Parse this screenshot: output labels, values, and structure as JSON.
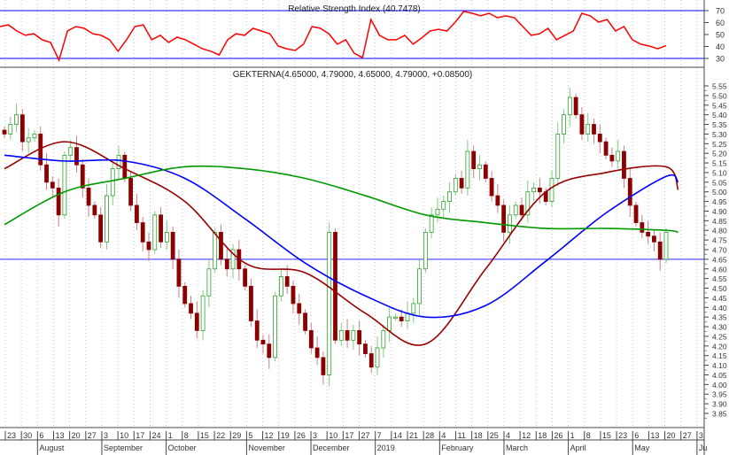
{
  "chart_data": {
    "type": "candlestick",
    "symbol_title": "GEKTERNA(4.65000, 4.79000, 4.65000, 4.79000, +0.08500)",
    "rsi_title": "Relative Strength Index (40.7478)",
    "price_ylim": [
      3.85,
      5.55
    ],
    "price_ticks": [
      "5.55",
      "5.50",
      "5.45",
      "5.40",
      "5.35",
      "5.30",
      "5.25",
      "5.20",
      "5.15",
      "5.10",
      "5.05",
      "5.00",
      "4.95",
      "4.90",
      "4.85",
      "4.80",
      "4.75",
      "4.70",
      "4.65",
      "4.60",
      "4.55",
      "4.50",
      "4.45",
      "4.40",
      "4.35",
      "4.30",
      "4.25",
      "4.20",
      "4.15",
      "4.10",
      "4.05",
      "4.00",
      "3.95",
      "3.90",
      "3.85"
    ],
    "rsi_ylim": [
      30,
      70
    ],
    "rsi_ticks": [
      "70",
      "60",
      "50",
      "40",
      "30"
    ],
    "rsi_levels": [
      70,
      30
    ],
    "support_level": 4.65,
    "week_labels": [
      "23",
      "30",
      "6",
      "13",
      "20",
      "27",
      "3",
      "10",
      "17",
      "24",
      "1",
      "8",
      "15",
      "22",
      "29",
      "5",
      "12",
      "19",
      "26",
      "3",
      "10",
      "17",
      "27",
      "7",
      "14",
      "21",
      "28",
      "4",
      "11",
      "18",
      "25",
      "4",
      "12",
      "18",
      "26",
      "1",
      "8",
      "15",
      "23",
      "6",
      "13",
      "20",
      "27",
      "3"
    ],
    "month_labels": [
      {
        "label": "August",
        "week_index": 2
      },
      {
        "label": "September",
        "week_index": 6
      },
      {
        "label": "October",
        "week_index": 10
      },
      {
        "label": "November",
        "week_index": 15
      },
      {
        "label": "December",
        "week_index": 19
      },
      {
        "label": "2019",
        "week_index": 23
      },
      {
        "label": "February",
        "week_index": 27
      },
      {
        "label": "March",
        "week_index": 31
      },
      {
        "label": "April",
        "week_index": 35
      },
      {
        "label": "May",
        "week_index": 39
      },
      {
        "label": "Ju",
        "week_index": 43
      }
    ],
    "closes": [
      5.3,
      5.35,
      5.4,
      5.26,
      5.28,
      5.3,
      5.14,
      5.05,
      5.02,
      4.88,
      5.19,
      5.23,
      5.14,
      5.02,
      4.93,
      4.88,
      4.74,
      4.98,
      5.12,
      5.19,
      5.07,
      4.93,
      4.84,
      4.74,
      4.7,
      4.88,
      4.74,
      4.79,
      4.65,
      4.51,
      4.42,
      4.37,
      4.28,
      4.46,
      4.6,
      4.79,
      4.65,
      4.6,
      4.7,
      4.6,
      4.51,
      4.33,
      4.23,
      4.21,
      4.14,
      4.46,
      4.56,
      4.51,
      4.42,
      4.37,
      4.28,
      4.19,
      4.14,
      4.05,
      4.79,
      4.23,
      4.28,
      4.23,
      4.28,
      4.21,
      4.16,
      4.09,
      4.19,
      4.28,
      4.35,
      4.35,
      4.33,
      4.37,
      4.42,
      4.6,
      4.79,
      4.88,
      4.91,
      4.95,
      5.0,
      5.07,
      5.02,
      5.21,
      5.12,
      5.14,
      5.07,
      4.98,
      4.93,
      4.79,
      4.88,
      4.93,
      4.88,
      5.0,
      5.02,
      5.0,
      4.95,
      5.07,
      5.3,
      5.4,
      5.49,
      5.4,
      5.3,
      5.35,
      5.3,
      5.26,
      5.19,
      5.16,
      5.21,
      5.07,
      4.93,
      4.84,
      4.79,
      4.77,
      4.74,
      4.65,
      4.79
    ],
    "ma_sample_indices": [
      0,
      10,
      20,
      30,
      40,
      50,
      60,
      70,
      80,
      90,
      100,
      110,
      112
    ],
    "moving_averages": [
      {
        "name": "MA20",
        "color": "#990000",
        "values": [
          5.12,
          5.26,
          5.12,
          4.95,
          4.63,
          4.58,
          4.37,
          4.21,
          4.6,
          5.0,
          5.1,
          5.13,
          5.01
        ]
      },
      {
        "name": "MA50",
        "color": "#0000ff",
        "values": [
          5.19,
          5.16,
          5.16,
          5.07,
          4.86,
          4.63,
          4.46,
          4.35,
          4.41,
          4.64,
          4.89,
          5.08,
          5.05
        ]
      },
      {
        "name": "MA200",
        "color": "#009900",
        "values": [
          4.83,
          5.0,
          5.07,
          5.13,
          5.12,
          5.07,
          4.98,
          4.88,
          4.84,
          4.81,
          4.81,
          4.8,
          4.79
        ]
      }
    ],
    "rsi_values": [
      56.7,
      58.1,
      53,
      49.3,
      50.7,
      45.6,
      43.3,
      28.5,
      53,
      56.7,
      55.2,
      50.7,
      49.3,
      45.6,
      36,
      45.6,
      56.7,
      58.1,
      45.6,
      49.3,
      43.3,
      47.8,
      45.6,
      41.9,
      38.1,
      36,
      33,
      45.6,
      50.7,
      49.3,
      55.2,
      53,
      50.7,
      40.4,
      38.1,
      36.7,
      41.9,
      56.7,
      55.2,
      50.7,
      41.9,
      45.6,
      34.4,
      30.7,
      62.6,
      49.3,
      45.6,
      45.6,
      49.3,
      41.9,
      47,
      53,
      54.4,
      53,
      60.4,
      69.3,
      67.8,
      65.6,
      67.8,
      64.1,
      65.6,
      64.1,
      56.7,
      49.3,
      50.7,
      55.2,
      45.6,
      49.3,
      53,
      67.8,
      65.6,
      60.4,
      62.6,
      53,
      56.7,
      45.6,
      41.9,
      40.4,
      38.1,
      40.7
    ],
    "colors": {
      "up": "#2ca02c",
      "down": "#8b0000",
      "rsi": "#ff0000",
      "level": "#0000ff",
      "support": "#7070ff",
      "grid": "#c8c8c8"
    }
  }
}
